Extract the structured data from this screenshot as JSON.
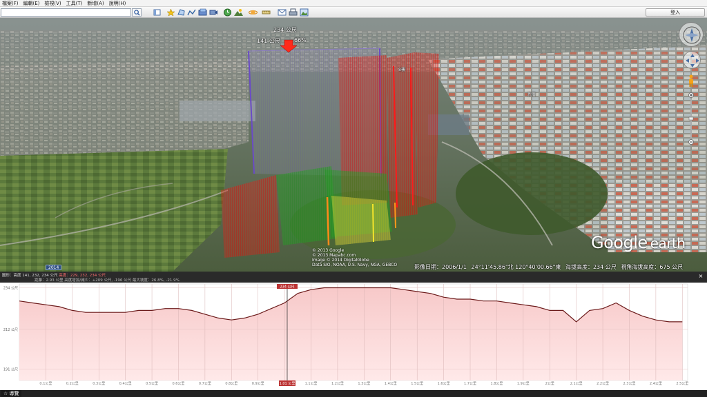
{
  "menu": {
    "items": [
      "檔案(F)",
      "編輯(E)",
      "檢視(V)",
      "工具(T)",
      "新增(A)",
      "說明(H)"
    ]
  },
  "toolbar": {
    "search_value": "",
    "signin_label": "登入",
    "icons": [
      "sidebar-icon",
      "placemark-icon",
      "polygon-icon",
      "path-icon",
      "image-overlay-icon",
      "tour-record-icon",
      "historical-imagery-icon",
      "sun-icon",
      "planets-icon",
      "ruler-icon",
      "email-icon",
      "print-icon",
      "save-image-icon"
    ]
  },
  "viewport": {
    "label_top": "234 公尺",
    "label_left": "141 公尺",
    "label_right": "66%",
    "label_building1": "8樓",
    "label_building2": "新厝",
    "status": {
      "imagery_date": "影像日期：2006/1/1",
      "coords": "24°11'45.86\"北 120°40'00.66\"東",
      "elevation": "海拔高度：234 公尺",
      "eye_alt": "視角海拔高度：675 公尺"
    },
    "copyright": [
      "© 2013 Google",
      "© 2013 Mapabc.com",
      "Image © 2014 DigitalGlobe",
      "Data SIO, NOAA, U.S. Navy, NGA, GEBCO"
    ],
    "year_badge": "2014",
    "logo_main": "Google",
    "logo_sub": "earth"
  },
  "profile": {
    "stats_prefix": "圖形：高度 141, 232, 234 公尺",
    "stats_selected": "高度：229, 232, 234 公尺",
    "stats_line2": "距離：2.93 公里 高度增加/減少：+209 公尺, -196 公尺 最大坡度：26.8%, -21.9%",
    "cursor_value": "234 公尺",
    "cursor_x_value": "1.01 公里",
    "y_tick_labels": [
      "234 公尺",
      "212 公尺",
      "191 公尺"
    ],
    "x_tick_labels": [
      "0.1公里",
      "0.2公里",
      "0.3公里",
      "0.4公里",
      "0.5公里",
      "0.6公里",
      "0.7公里",
      "0.8公里",
      "0.9公里",
      "1公里",
      "1.1公里",
      "1.2公里",
      "1.3公里",
      "1.4公里",
      "1.5公里",
      "1.6公里",
      "1.7公里",
      "1.8公里",
      "1.9公里",
      "2公里",
      "2.1公里",
      "2.2公里",
      "2.3公里",
      "2.4公里",
      "2.5公里"
    ],
    "close_label": "×"
  },
  "bottom": {
    "tour_label": "☆ 導覽"
  },
  "chart_data": {
    "type": "area",
    "title": "",
    "xlabel": "",
    "ylabel": "",
    "x": [
      0,
      0.05,
      0.1,
      0.15,
      0.2,
      0.25,
      0.3,
      0.35,
      0.4,
      0.45,
      0.5,
      0.55,
      0.6,
      0.65,
      0.7,
      0.75,
      0.8,
      0.85,
      0.9,
      0.95,
      1.0,
      1.05,
      1.1,
      1.15,
      1.2,
      1.25,
      1.3,
      1.35,
      1.4,
      1.45,
      1.5,
      1.55,
      1.6,
      1.65,
      1.7,
      1.75,
      1.8,
      1.85,
      1.9,
      1.95,
      2.0,
      2.05,
      2.1,
      2.15,
      2.2,
      2.25,
      2.3,
      2.35,
      2.4,
      2.45,
      2.5
    ],
    "series": [
      {
        "values": [
          227,
          226,
          225,
          224,
          222,
          221,
          221,
          221,
          221,
          222,
          222,
          223,
          223,
          222,
          220,
          218,
          217,
          218,
          220,
          223,
          226,
          231,
          233,
          234,
          234,
          234,
          234,
          234,
          234,
          233,
          232,
          231,
          229,
          228,
          228,
          227,
          227,
          226,
          225,
          224,
          222,
          222,
          216,
          222,
          223,
          226,
          222,
          219,
          217,
          216,
          216
        ]
      }
    ],
    "ylim": [
      185,
      236
    ],
    "xlim": [
      0,
      2.52
    ],
    "cursor_x": 1.01,
    "grid": true,
    "colors": {
      "line": "#6b1a1a",
      "fill": "#f7c9c9",
      "fill_bottom": "#ffe9e9"
    }
  }
}
